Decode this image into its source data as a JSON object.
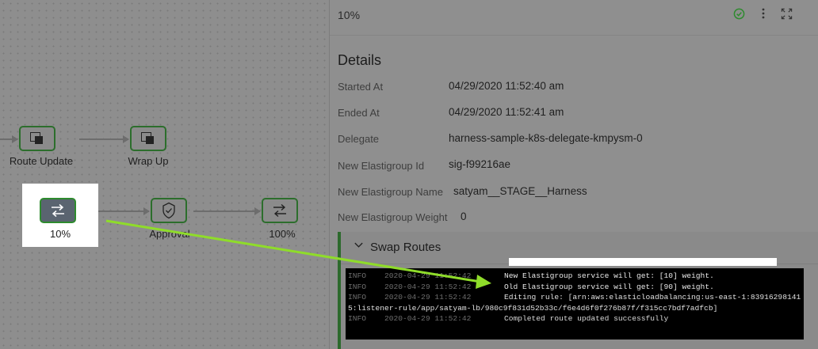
{
  "workflow": {
    "nodes": [
      {
        "label": "Route Update",
        "icon": "split-square-icon"
      },
      {
        "label": "Wrap Up",
        "icon": "split-square-icon"
      },
      {
        "label": "10%",
        "icon": "swap-arrows-icon"
      },
      {
        "label": "Approval",
        "icon": "shield-check-icon"
      },
      {
        "label": "100%",
        "icon": "swap-arrows-icon"
      }
    ]
  },
  "panel": {
    "title": "10%",
    "status_icon": "check-circle-icon",
    "status_color": "#2e8b2e",
    "details_title": "Details",
    "rows": [
      {
        "label": "Started At",
        "value": "04/29/2020 11:52:40 am"
      },
      {
        "label": "Ended At",
        "value": "04/29/2020 11:52:41 am"
      },
      {
        "label": "Delegate",
        "value": "harness-sample-k8s-delegate-kmpysm-0"
      },
      {
        "label": "New Elastigroup Id",
        "value": "sig-f99216ae"
      },
      {
        "label": "New Elastigroup Name",
        "value": "satyam__STAGE__Harness"
      },
      {
        "label": "New Elastigroup Weight",
        "value": "0"
      }
    ],
    "section": {
      "title": "Swap Routes",
      "log": [
        {
          "level": "INFO",
          "time": "2020-04-29 11:52:42",
          "msg": "New Elastigroup service will get: [10] weight."
        },
        {
          "level": "INFO",
          "time": "2020-04-29 11:52:42",
          "msg": "Old Elastigroup service will get: [90] weight."
        },
        {
          "level": "INFO",
          "time": "2020-04-29 11:52:42",
          "msg": "Editing rule: [arn:aws:elasticloadbalancing:us-east-1:839162981415:listener-rule/app/satyam-lb/980c9f831d52b33c/f6e4d6f0f276b87f/f315cc7bdf7adfcb]"
        },
        {
          "level": "INFO",
          "time": "2020-04-29 11:52:42",
          "msg": "Completed route updated successfully"
        }
      ]
    }
  },
  "annotation_color": "#8fdc2a"
}
